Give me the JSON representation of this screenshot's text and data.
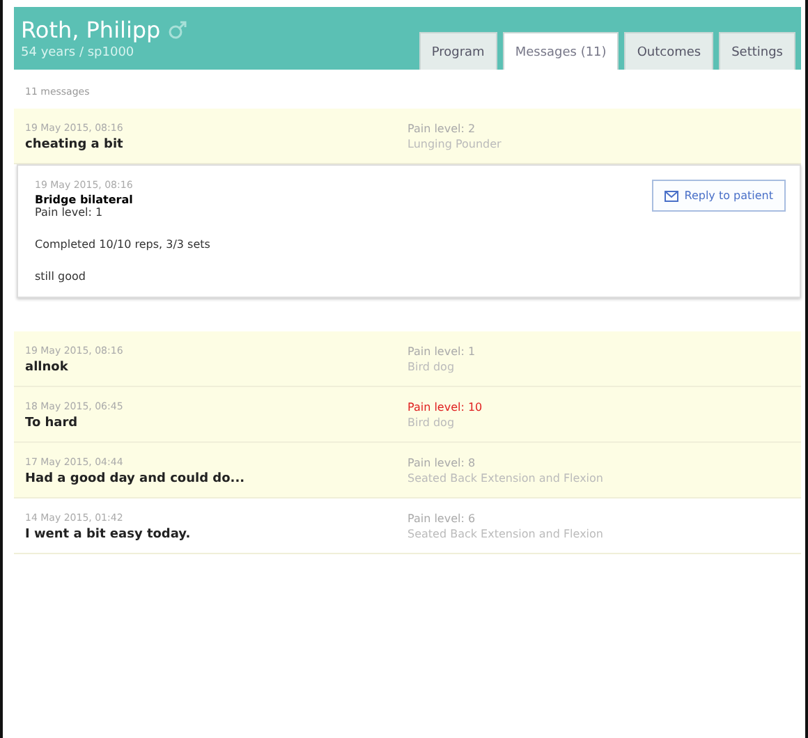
{
  "patient": {
    "name": "Roth, Philipp",
    "subtitle": "54 years / sp1000"
  },
  "tabs": [
    {
      "label": "Program",
      "selected": false
    },
    {
      "label": "Messages (11)",
      "selected": true
    },
    {
      "label": "Outcomes",
      "selected": false
    },
    {
      "label": "Settings",
      "selected": false
    }
  ],
  "count": "11 messages",
  "messages": [
    {
      "date": "19 May 2015, 08:16",
      "text": "cheating a bit",
      "pain": "Pain level: 2",
      "exercise": "Lunging Pounder",
      "unread": true,
      "alert": false,
      "detail": {
        "date": "19 May 2015, 08:16",
        "exercise": "Bridge bilateral",
        "pain": "Pain level: 1",
        "summary": "Completed 10/10 reps, 3/3 sets",
        "comment": "still good",
        "button": "Reply to patient"
      }
    },
    {
      "date": "19 May 2015, 08:16",
      "text": "allnok",
      "pain": "Pain level: 1",
      "exercise": "Bird dog",
      "unread": true,
      "alert": false
    },
    {
      "date": "18 May 2015, 06:45",
      "text": "To hard",
      "pain": "Pain level: 10",
      "exercise": "Bird dog",
      "unread": true,
      "alert": true
    },
    {
      "date": "17 May 2015, 04:44",
      "text": "Had a good day and could do...",
      "pain": "Pain level: 8",
      "exercise": "Seated Back Extension and Flexion",
      "unread": true,
      "alert": false
    },
    {
      "date": "14 May 2015, 01:42",
      "text": "I went a bit easy today.",
      "pain": "Pain level: 6",
      "exercise": "Seated Back Extension and Flexion",
      "unread": false,
      "alert": false
    }
  ]
}
